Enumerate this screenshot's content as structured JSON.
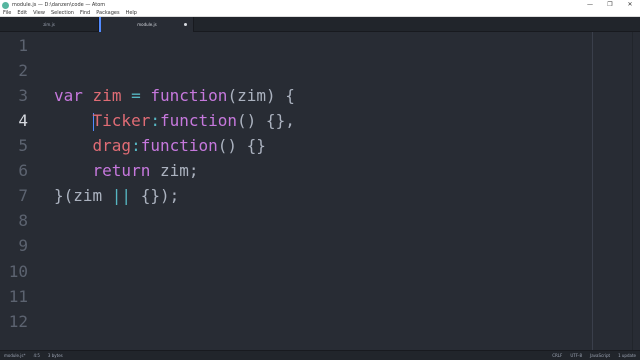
{
  "window": {
    "title": "module.js — D:\\danzen\\code — Atom",
    "minimize": "—",
    "maximize": "❐",
    "close": "✕"
  },
  "menu": [
    "File",
    "Edit",
    "View",
    "Selection",
    "Find",
    "Packages",
    "Help"
  ],
  "tabs": [
    {
      "label": "zim.js",
      "active": false
    },
    {
      "label": "module.js",
      "active": true,
      "modified": true
    }
  ],
  "editor": {
    "line_numbers": [
      "1",
      "2",
      "3",
      "4",
      "5",
      "6",
      "7",
      "8",
      "9",
      "10",
      "11",
      "12"
    ],
    "cursor_line": "4",
    "code": {
      "l3": {
        "kw": "var",
        "name": "zim",
        "eq": "=",
        "fn": "function",
        "rest": "(zim) {"
      },
      "l4": {
        "prop": "Ticker",
        "colon": ":",
        "fn": "function",
        "rest": "() {},"
      },
      "l5": {
        "prop": "drag",
        "colon": ":",
        "fn": "function",
        "rest": "() {}"
      },
      "l6": {
        "kw": "return",
        "rest": " zim;"
      },
      "l7": {
        "open": "}(zim ",
        "op": "||",
        "close": " {});"
      }
    }
  },
  "status": {
    "file": "module.js*",
    "position": "4:5",
    "selection": "3 bytes",
    "line_ending": "CRLF",
    "encoding": "UTF-8",
    "grammar": "JavaScript",
    "updates": "1 update"
  },
  "colors": {
    "background": "#282c34",
    "keyword": "#c678dd",
    "function": "#61afef",
    "property": "#e06c75",
    "operator": "#56b6c2",
    "text": "#abb2bf",
    "line_number": "#5c6370",
    "cursor": "#528bff"
  }
}
